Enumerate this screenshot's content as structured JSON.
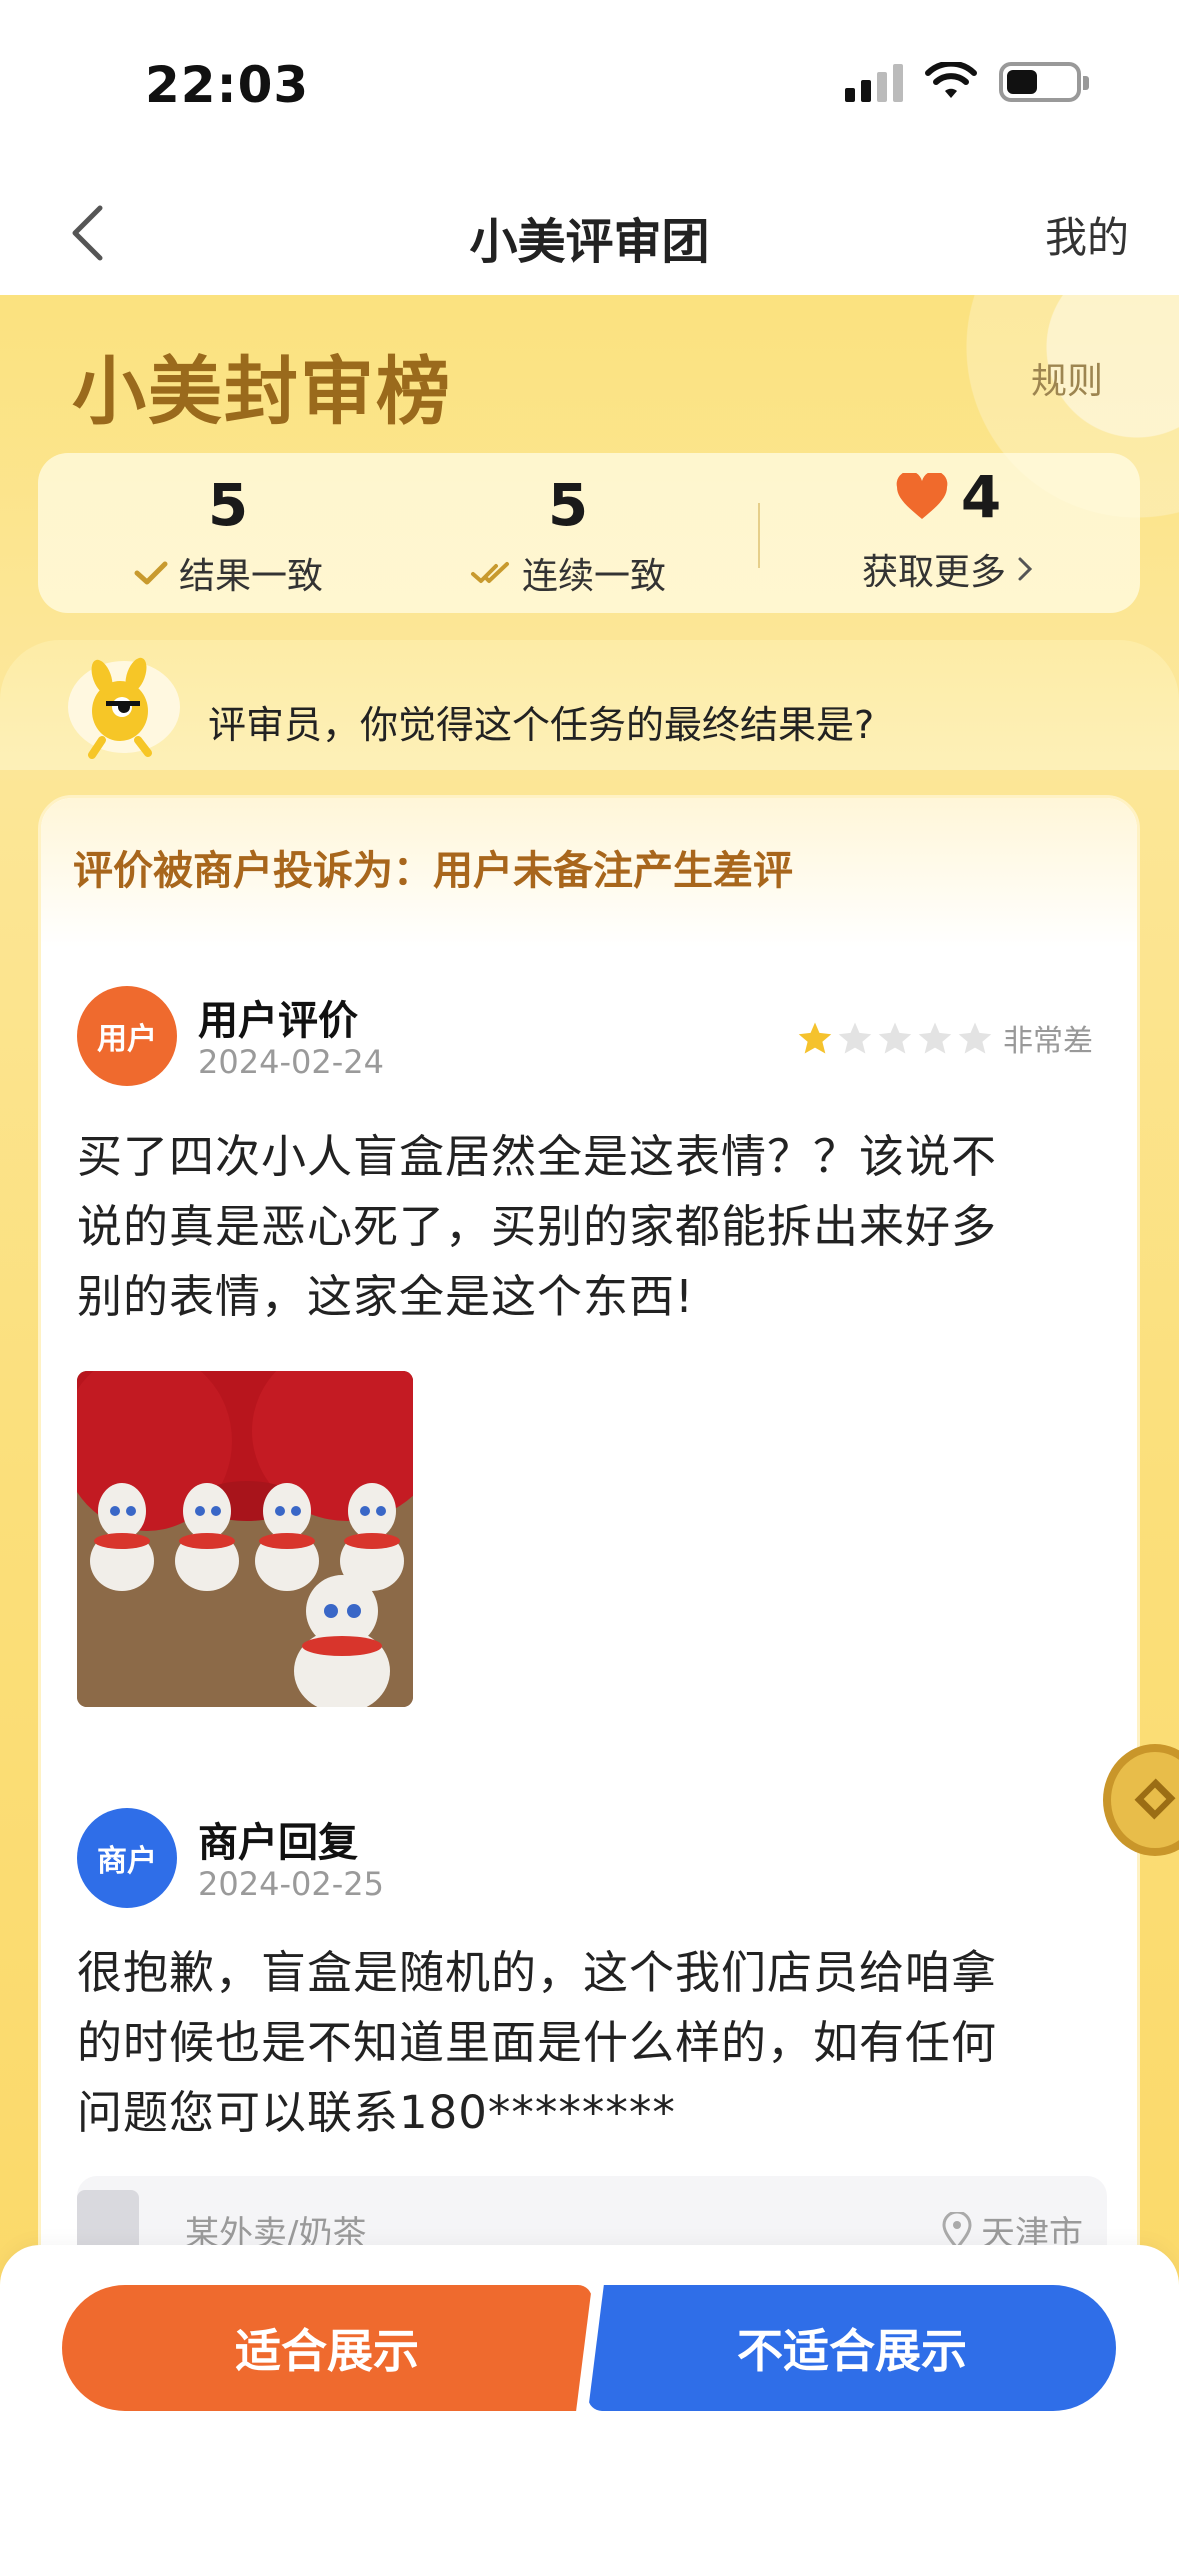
{
  "status_bar": {
    "time": "22:03"
  },
  "nav": {
    "title": "小美评审团",
    "mine": "我的"
  },
  "hero": {
    "title": "小美封审榜",
    "rules": "规则"
  },
  "stats": [
    {
      "value": "5",
      "label": "结果一致"
    },
    {
      "value": "5",
      "label": "连续一致"
    },
    {
      "value": "4",
      "label": "获取更多"
    }
  ],
  "question": "评审员，你觉得这个任务的最终结果是?",
  "complaint": "评价被商户投诉为：用户未备注产生差评",
  "user_review": {
    "avatar_label": "用户",
    "title": "用户评价",
    "date": "2024-02-24",
    "rating": 1,
    "rating_max": 5,
    "rating_text": "非常差",
    "lines": [
      "买了四次小人盲盒居然全是这表情？？该说不",
      "说的真是恶心死了，买别的家都能拆出来好多",
      "别的表情，这家全是这个东西!"
    ]
  },
  "merchant_reply": {
    "avatar_label": "商户",
    "title": "商户回复",
    "date": "2024-02-25",
    "lines": [
      "很抱歉，盲盒是随机的，这个我们店员给咱拿",
      "的时候也是不知道里面是什么样的，如有任何",
      "问题您可以联系180********"
    ]
  },
  "shop": {
    "name": "某外卖/奶茶",
    "city": "天津市"
  },
  "actions": {
    "suitable": "适合展示",
    "unsuitable": "不适合展示"
  },
  "colors": {
    "accent_orange": "#ef6a2e",
    "accent_blue": "#2f6ee8",
    "hero_yellow": "#fbe27f",
    "title_gold": "#9a6a1c"
  }
}
